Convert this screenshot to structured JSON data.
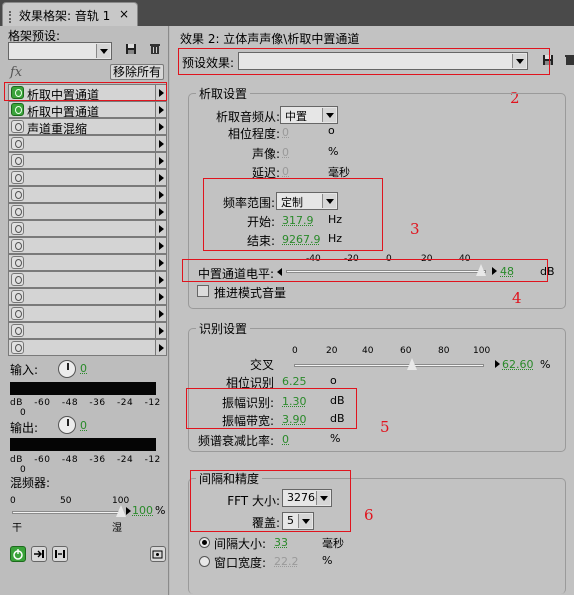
{
  "window": {
    "tab_title": "效果格架: 音轨 1",
    "close_glyph": "×"
  },
  "left": {
    "preset_label": "格架预设:",
    "fx_label": "fx",
    "remove_all_label": "移除所有",
    "rack": [
      {
        "name": "析取中置通道",
        "on": true
      },
      {
        "name": "析取中置通道",
        "on": true
      },
      {
        "name": "声道重混缩",
        "on": false
      },
      {
        "name": "",
        "on": false
      },
      {
        "name": "",
        "on": false
      },
      {
        "name": "",
        "on": false
      },
      {
        "name": "",
        "on": false
      },
      {
        "name": "",
        "on": false
      },
      {
        "name": "",
        "on": false
      },
      {
        "name": "",
        "on": false
      },
      {
        "name": "",
        "on": false
      },
      {
        "name": "",
        "on": false
      },
      {
        "name": "",
        "on": false
      },
      {
        "name": "",
        "on": false
      },
      {
        "name": "",
        "on": false
      },
      {
        "name": "",
        "on": false
      }
    ],
    "input_label": "输入:",
    "input_value": "0",
    "output_label": "输出:",
    "output_value": "0",
    "meter_scale": [
      "dB",
      "-60",
      "-48",
      "-36",
      "-24",
      "-12",
      "0"
    ],
    "mixer_label": "混频器:",
    "mixer_ticks": [
      "0",
      "50",
      "100"
    ],
    "mixer_value": "100",
    "mixer_unit": "%",
    "mixer_dry": "干",
    "mixer_wet": "湿",
    "mixer_level": 1.0,
    "annot_1": "1"
  },
  "right": {
    "effect_title": "效果 2: 立体声声像\\析取中置通道",
    "preset_label": "预设效果:",
    "extract": {
      "title": "析取设置",
      "extract_from_label": "析取音频从:",
      "extract_from_value": "中置",
      "phase_label": "相位程度:",
      "phase_value": "0",
      "phase_unit": "o",
      "pan_label": "声像:",
      "pan_value": "0",
      "pan_unit": "%",
      "delay_label": "延迟:",
      "delay_value": "0",
      "delay_unit": "毫秒",
      "freq_range_label": "频率范围:",
      "freq_range_value": "定制",
      "start_label": "开始:",
      "start_value": "317.9",
      "start_unit": "Hz",
      "end_label": "结束:",
      "end_value": "9267.9",
      "end_unit": "Hz",
      "center_level_label": "中置通道电平:",
      "center_level_ticks": [
        "-40",
        "-20",
        "0",
        "20",
        "40"
      ],
      "center_level_value": "48",
      "center_level_unit": "dB",
      "advanced_mode_label": "推进模式音量"
    },
    "recognition": {
      "title": "识别设置",
      "crossover_label": "交叉",
      "crossover_ticks": [
        "0",
        "20",
        "40",
        "60",
        "80",
        "100"
      ],
      "crossover_value": "62.60",
      "crossover_unit": "%",
      "phase_recog_label": "相位识别",
      "phase_recog_value": "6.25",
      "phase_recog_unit": "o",
      "amp_recog_label": "振幅识别:",
      "amp_recog_value": "1.30",
      "amp_recog_unit": "dB",
      "amp_band_label": "振幅带宽:",
      "amp_band_value": "3.90",
      "amp_band_unit": "dB",
      "spectral_decay_label": "频谱衰减比率:",
      "spectral_decay_value": "0",
      "spectral_decay_unit": "%"
    },
    "spacing": {
      "title": "间隔和精度",
      "fft_label": "FFT 大小:",
      "fft_value": "32768",
      "overlap_label": "覆盖:",
      "overlap_value": "5",
      "interval_label": "间隔大小:",
      "interval_value": "33",
      "interval_unit": "毫秒",
      "window_label": "窗口宽度:",
      "window_value": "22.2",
      "window_unit": "%"
    },
    "annot_2": "2",
    "annot_3": "3",
    "annot_4": "4",
    "annot_5": "5",
    "annot_6": "6"
  },
  "colors": {
    "annotation_red": "#e0141e",
    "value_green": "#2a8a2a",
    "power_on": "#3aa33a"
  }
}
